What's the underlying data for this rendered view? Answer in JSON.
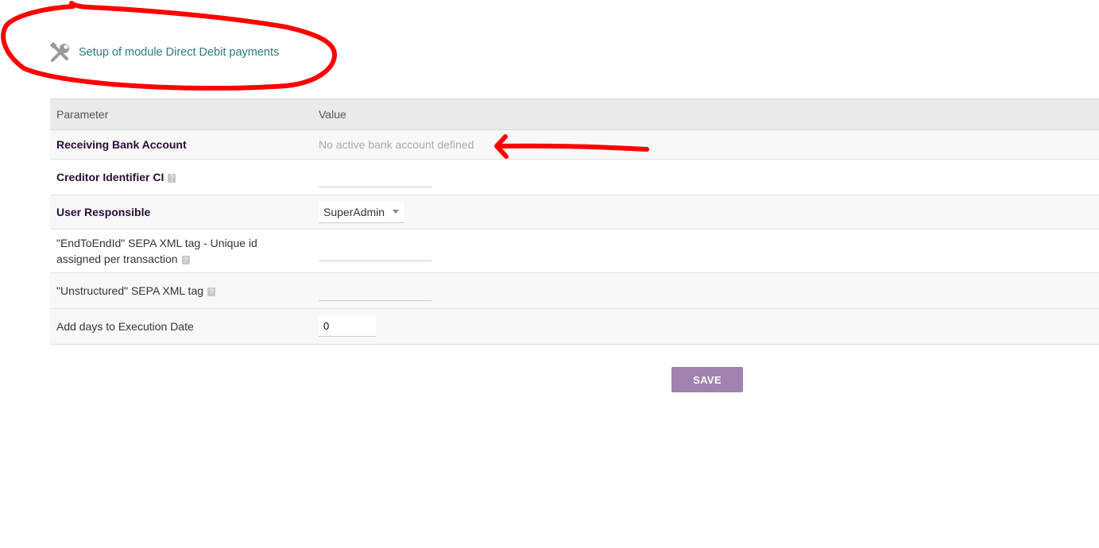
{
  "header": {
    "title": "Setup of module Direct Debit payments",
    "icon": "tools-icon"
  },
  "table": {
    "columns": [
      "Parameter",
      "Value"
    ],
    "rows": [
      {
        "label": "Receiving Bank Account",
        "value": "No active bank account defined"
      },
      {
        "label": "Creditor Identifier CI",
        "value": ""
      },
      {
        "label": "User Responsible",
        "value": "SuperAdmin"
      },
      {
        "label_line1": "\"EndToEndId\" SEPA XML tag - Unique id",
        "label_line2": "assigned per transaction",
        "value": ""
      },
      {
        "label": "\"Unstructured\" SEPA XML tag",
        "value": ""
      },
      {
        "label": "Add days to Execution Date",
        "value": "0"
      }
    ]
  },
  "help_glyph": "?",
  "actions": {
    "save_label": "SAVE"
  },
  "colors": {
    "title_link": "#2a7a80",
    "strong_label": "#2c0b3d",
    "save_button": "#a181ad",
    "annotation": "#ff0000"
  }
}
